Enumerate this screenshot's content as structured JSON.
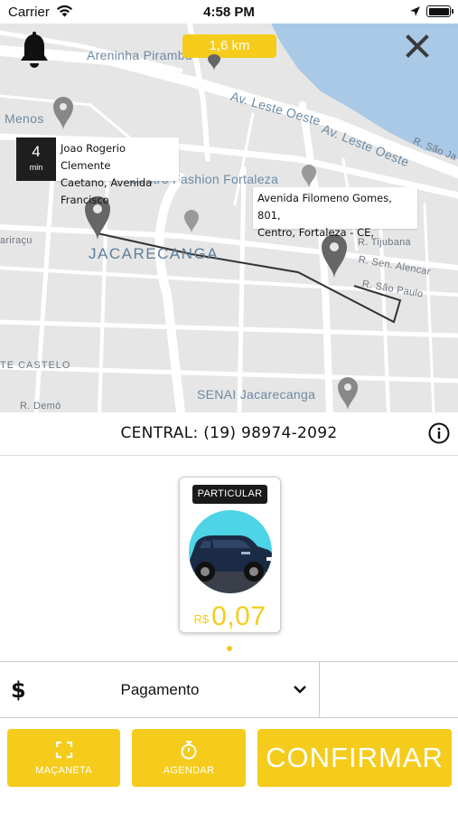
{
  "status_bar": {
    "carrier": "Carrier",
    "time": "4:58 PM"
  },
  "map": {
    "distance": "1,6 km",
    "eta": {
      "value": "4",
      "unit": "min"
    },
    "origin_address": [
      "Joao Rogerio Clemente",
      "Caetano, Avenida Francisco"
    ],
    "destination_address": [
      "Avenida Filomeno Gomes, 801,",
      "Centro, Fortaleza - CE,"
    ],
    "labels": {
      "areninha": "Areninha Pirambu",
      "menos": "Menos",
      "leste_oeste_1": "Av. Leste Oeste",
      "leste_oeste_2": "Av. Leste Oeste",
      "sao_jao": "R. São Ja",
      "fashion": "Centro Fashion Fortaleza",
      "jacarecanga": "JACARECANGA",
      "iracu": "ariraçu",
      "tijubana": "R. Tijubana",
      "sen_alencar": "R. Sen. Alencar",
      "sao_paulo": "R. São Paulo",
      "castelo": "TE CASTELO",
      "senai": "SENAI Jacarecanga",
      "demo": "R. Demó"
    },
    "colors": {
      "land": "#e6e6e6",
      "water": "#a9c9e6",
      "road": "#ffffff",
      "route": "#333333",
      "pin": "#666666"
    }
  },
  "central": {
    "text": "CENTRAL: (19) 98974-2092"
  },
  "vehicle": {
    "label": "PARTICULAR",
    "currency": "R$",
    "price": "0,07"
  },
  "payment": {
    "icon": "$",
    "label": "Pagamento"
  },
  "buttons": {
    "macaneta": "MAÇANETA",
    "agendar": "AGENDAR",
    "confirmar": "CONFIRMAR"
  },
  "accent_color": "#f5cc1c"
}
